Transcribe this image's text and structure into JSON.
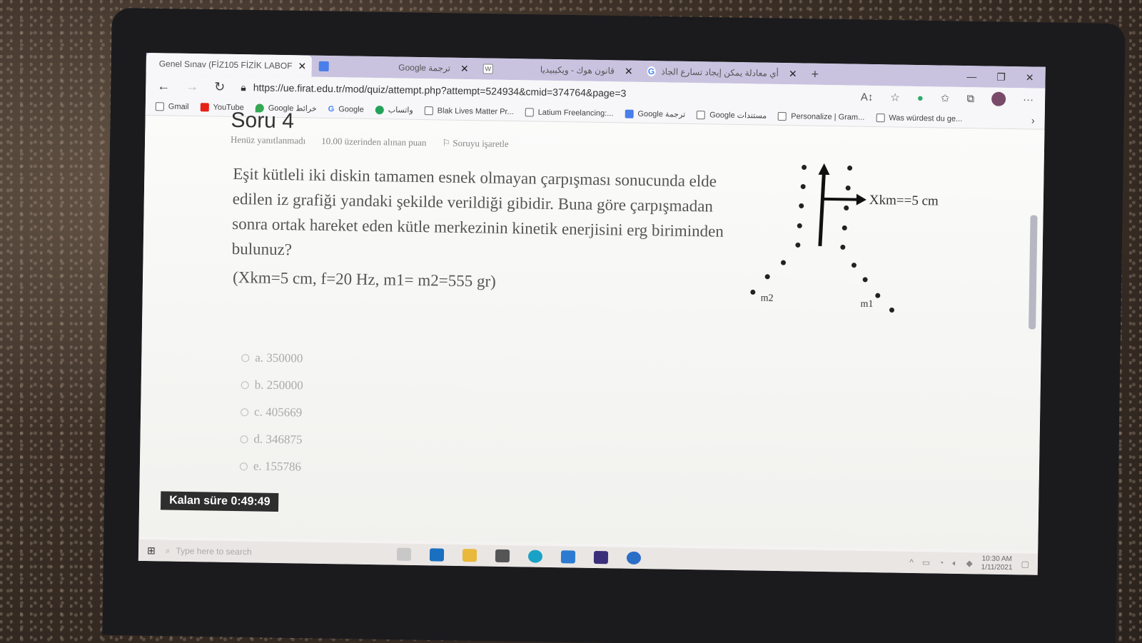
{
  "browser": {
    "tabs": [
      {
        "label": "Genel Sınav (FİZ105 FİZİK LABOF",
        "active": true
      },
      {
        "label": "Google ترجمة",
        "active": false
      },
      {
        "label": "قانون هوك - ويكيبيديا",
        "active": false
      },
      {
        "label": "أي معادلة يمكن إيجاد تسارع الجاذ",
        "active": false
      }
    ],
    "url": "https://ue.firat.edu.tr/mod/quiz/attempt.php?attempt=524934&cmid=374764&page=3",
    "bookmarks": [
      {
        "label": "Gmail",
        "icon": "page-icon"
      },
      {
        "label": "YouTube",
        "icon": "youtube-icon"
      },
      {
        "label": "Google خرائط",
        "icon": "maps-icon"
      },
      {
        "label": "Google",
        "icon": "google-icon"
      },
      {
        "label": "واتساب",
        "icon": "whatsapp-icon"
      },
      {
        "label": "Blak Lives Matter Pr...",
        "icon": "page-icon"
      },
      {
        "label": "Latium Freelancing:...",
        "icon": "page-icon"
      },
      {
        "label": "Google ترجمة",
        "icon": "translate-icon"
      },
      {
        "label": "Google مستندات",
        "icon": "page-icon"
      },
      {
        "label": "Personalize | Gram...",
        "icon": "page-icon"
      },
      {
        "label": "Was würdest du ge...",
        "icon": "page-icon"
      }
    ]
  },
  "question": {
    "title": "Soru 4",
    "status": "Henüz yanıtlanmadı",
    "points": "10.00 üzerinden alınan puan",
    "flag": "Soruyu işaretle",
    "text": "Eşit kütleli iki diskin tamamen esnek olmayan çarpışması sonucunda elde edilen iz grafiği yandaki şekilde verildiği gibidir. Buna göre çarpışmadan sonra ortak hareket eden kütle merkezinin kinetik enerjisini erg biriminden bulunuz?",
    "given": "(Xkm=5 cm, f=20 Hz, m1= m2=555 gr)",
    "figure": {
      "label_x": "Xkm==5 cm",
      "label_m2": "m2",
      "label_m1": "m1"
    },
    "answers": [
      {
        "label": "a. 350000"
      },
      {
        "label": "b. 250000"
      },
      {
        "label": "c. 405669"
      },
      {
        "label": "d. 346875"
      },
      {
        "label": "e. 155786"
      }
    ]
  },
  "timer": {
    "label": "Kalan süre 0:49:49"
  },
  "taskbar": {
    "search_placeholder": "Type here to search",
    "time": "10:30 AM",
    "date": "1/11/2021"
  }
}
